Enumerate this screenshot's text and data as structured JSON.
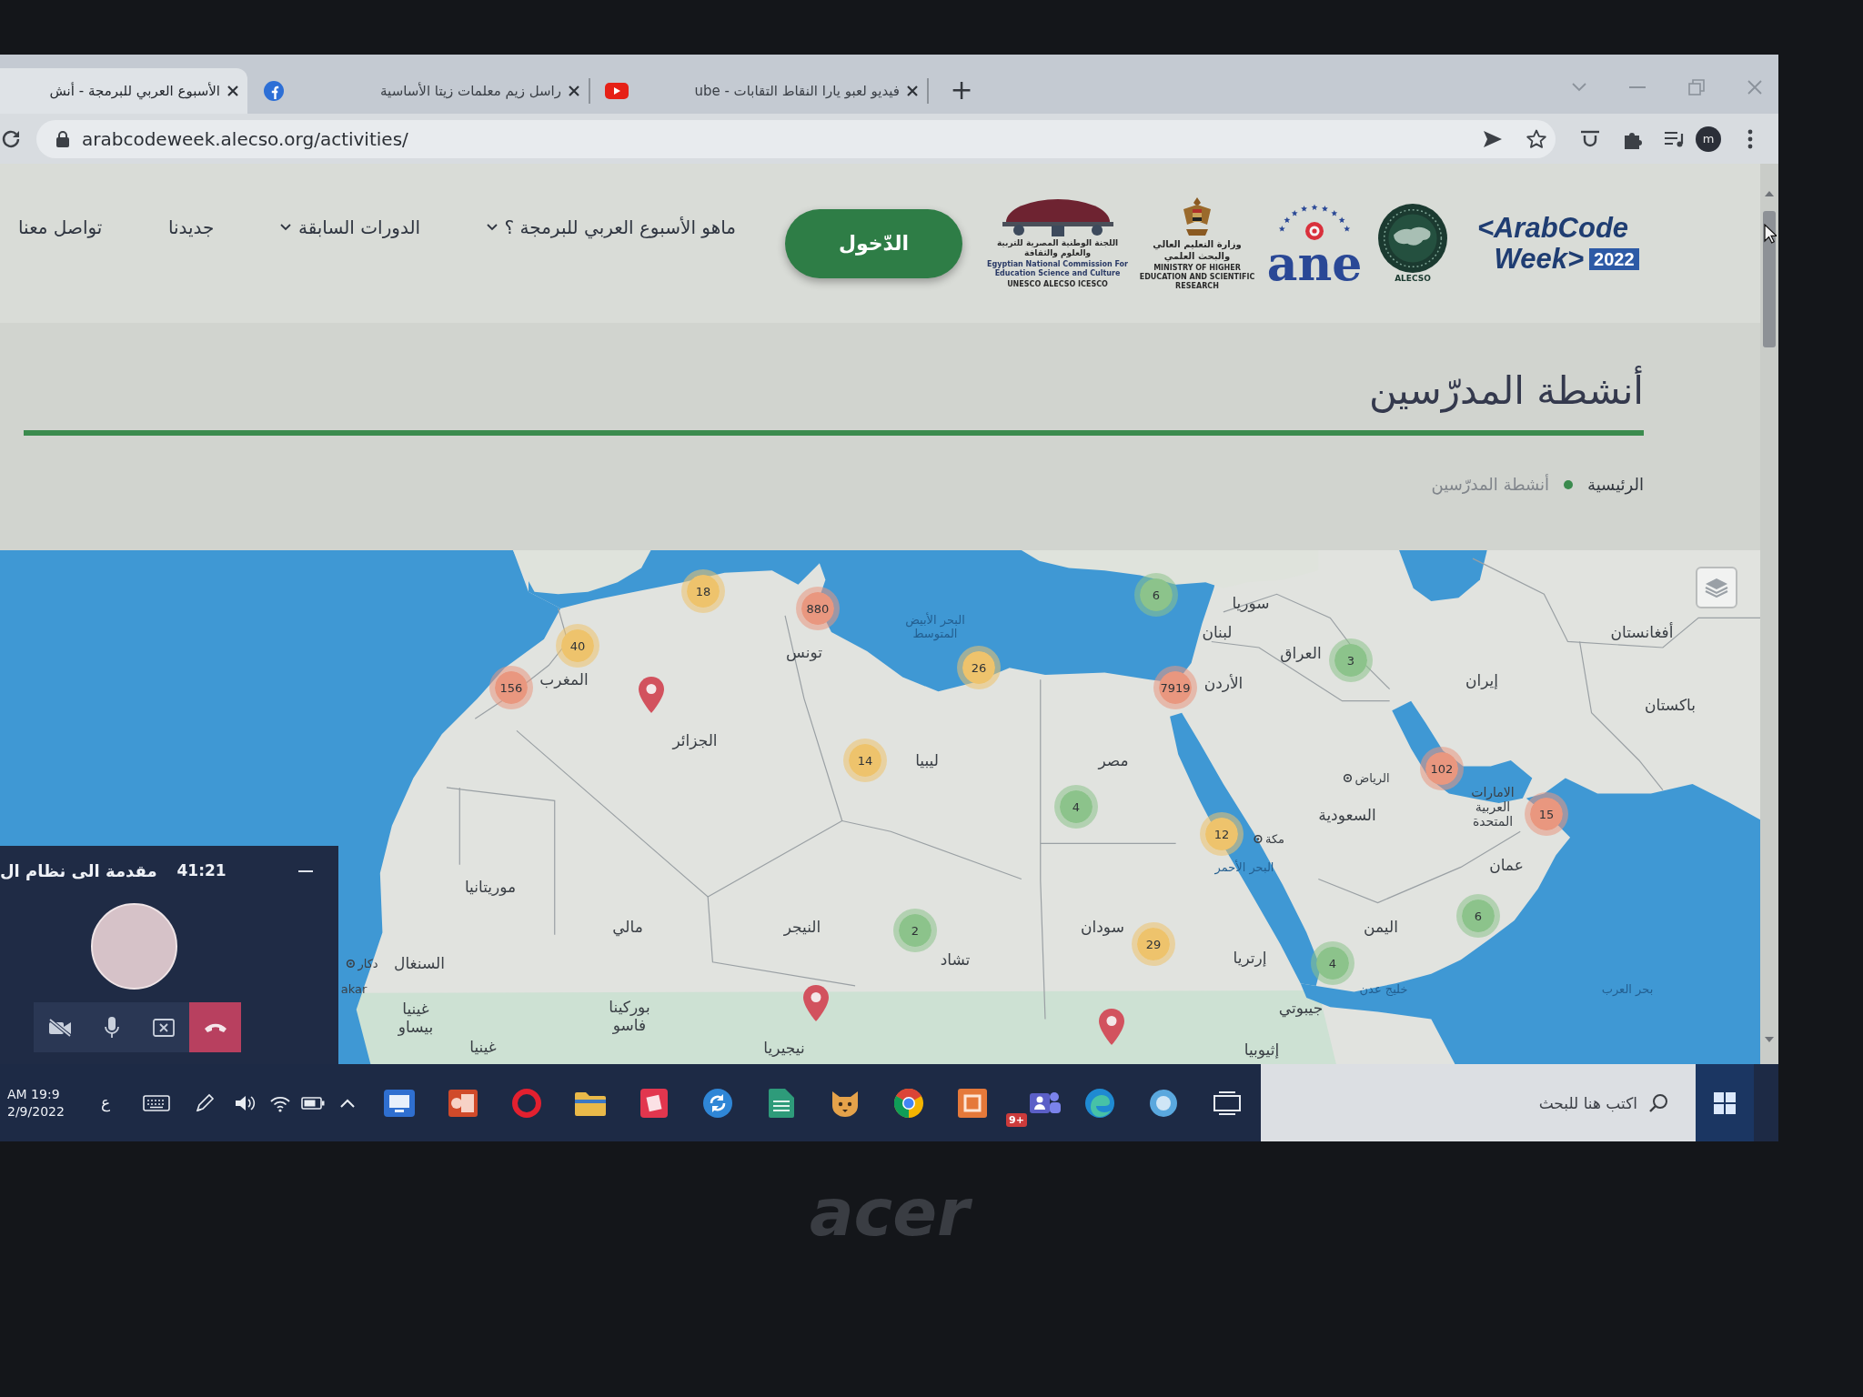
{
  "browser": {
    "tabs": [
      {
        "title": "فيديو لعبو يارا النقاط التقابات - ube",
        "kind": "video",
        "selected": false
      },
      {
        "title": "راسل زيم معلمات زيتا الأساسية",
        "kind": "social",
        "selected": false
      },
      {
        "title": "الأسبوع العربي للبرمجة - أنش",
        "kind": "page",
        "selected": true
      }
    ],
    "new_tab": "+",
    "url": "arabcodeweek.alecso.org/activities/",
    "profile_initial": "m"
  },
  "site_header": {
    "logos": [
      {
        "kind": "arabcodeweek",
        "lines": [
          "<ArabCode",
          "Week>"
        ],
        "year": "2022"
      },
      {
        "kind": "alecso",
        "caption": "ALECSO"
      },
      {
        "kind": "ane",
        "wordmark": "ane"
      },
      {
        "kind": "ministry",
        "arabic": "وزارة التعليم العالي والبحث العلمي",
        "english": "MINISTRY OF HIGHER EDUCATION AND SCIENTIFIC RESEARCH"
      },
      {
        "kind": "commission",
        "arabic": "اللجنة الوطنية المصرية للتربية والعلوم والثقافة",
        "english": "Egyptian National Commission For Education Science and Culture",
        "partners": "UNESCO ALECSO ICESCO"
      }
    ],
    "login": "الدّخول",
    "nav": [
      {
        "label": "ماهو الأسبوع العربي للبرمجة ؟",
        "dropdown": true
      },
      {
        "label": "الدورات السابقة",
        "dropdown": true
      },
      {
        "label": "جديدنا",
        "dropdown": false
      },
      {
        "label": "تواصل معنا",
        "dropdown": false
      }
    ]
  },
  "page_title": "أنشطة المدرّسين",
  "breadcrumb": [
    {
      "label": "الرئيسية",
      "current": false
    },
    {
      "label": "أنشطة المدرّسين",
      "current": true
    }
  ],
  "map": {
    "clusters": [
      {
        "count": "18",
        "color": "#eec36c"
      },
      {
        "count": "6",
        "color": "#8cc38b"
      },
      {
        "count": "880",
        "color": "#e9977f"
      },
      {
        "count": "40",
        "color": "#eec36c"
      },
      {
        "count": "3",
        "color": "#8cc38b"
      },
      {
        "count": "26",
        "color": "#eec36c"
      },
      {
        "count": "156",
        "color": "#e9977f"
      },
      {
        "count": "7919",
        "color": "#e9977f"
      },
      {
        "count": "14",
        "color": "#eec36c"
      },
      {
        "count": "102",
        "color": "#e9977f"
      },
      {
        "count": "4",
        "color": "#8cc38b"
      },
      {
        "count": "15",
        "color": "#e9977f"
      },
      {
        "count": "12",
        "color": "#eec36c"
      },
      {
        "count": "6",
        "color": "#8cc38b"
      },
      {
        "count": "2",
        "color": "#8cc38b"
      },
      {
        "count": "29",
        "color": "#eec36c"
      },
      {
        "count": "4",
        "color": "#8cc38b"
      }
    ],
    "labels": [
      {
        "text": "سوريا",
        "kind": "country"
      },
      {
        "text": "أفغانستان",
        "kind": "country"
      },
      {
        "text": "لبنان",
        "kind": "country"
      },
      {
        "text": "البحر الأبيض المتوسط",
        "kind": "sea"
      },
      {
        "text": "العراق",
        "kind": "country"
      },
      {
        "text": "تونس",
        "kind": "country"
      },
      {
        "text": "إيران",
        "kind": "country"
      },
      {
        "text": "الأردن",
        "kind": "country"
      },
      {
        "text": "المغرب",
        "kind": "country"
      },
      {
        "text": "باكستان",
        "kind": "country"
      },
      {
        "text": "الجزائر",
        "kind": "country"
      },
      {
        "text": "مصر",
        "kind": "country"
      },
      {
        "text": "ليبيا",
        "kind": "country"
      },
      {
        "text": "الرياض",
        "kind": "city"
      },
      {
        "text": "الامارات العربية المتحدة",
        "kind": "country"
      },
      {
        "text": "السعودية",
        "kind": "country"
      },
      {
        "text": "مكة",
        "kind": "city"
      },
      {
        "text": "عمان",
        "kind": "country"
      },
      {
        "text": "البحر الأحمر",
        "kind": "sea"
      },
      {
        "text": "موريتانيا",
        "kind": "country"
      },
      {
        "text": "اليمن",
        "kind": "country"
      },
      {
        "text": "سودان",
        "kind": "country"
      },
      {
        "text": "النيجر",
        "kind": "country"
      },
      {
        "text": "مالي",
        "kind": "country"
      },
      {
        "text": "إرتريا",
        "kind": "country"
      },
      {
        "text": "تشاد",
        "kind": "country"
      },
      {
        "text": "السنغال",
        "kind": "country"
      },
      {
        "text": "دكار",
        "kind": "city"
      },
      {
        "text": "بحر العرب",
        "kind": "sea"
      },
      {
        "text": "خليج عدن",
        "kind": "sea"
      },
      {
        "text": "akar",
        "kind": "fragment"
      },
      {
        "text": "جيبوتي",
        "kind": "country"
      },
      {
        "text": "بوركينا فاسو",
        "kind": "country"
      },
      {
        "text": "غينيا بيساو",
        "kind": "country"
      },
      {
        "text": "إثيوبيا",
        "kind": "country"
      },
      {
        "text": "نيجيريا",
        "kind": "country"
      },
      {
        "text": "غينيا",
        "kind": "country"
      }
    ]
  },
  "call_widget": {
    "title": "مقدمة الى نظام ال",
    "timer": "41:21",
    "controls": [
      {
        "kind": "camera-off"
      },
      {
        "kind": "mic"
      },
      {
        "kind": "share-screen"
      },
      {
        "kind": "hang-up"
      }
    ]
  },
  "taskbar": {
    "clock": {
      "time": "AM 19:9",
      "date": "2/9/2022"
    },
    "language": "ع",
    "badge": "9+",
    "search": {
      "placeholder": "اكتب هنا للبحث"
    }
  },
  "laptop": {
    "brand": "acer"
  }
}
